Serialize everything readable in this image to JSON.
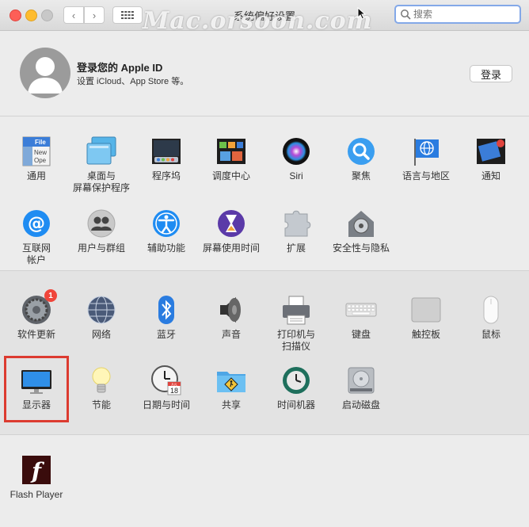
{
  "window": {
    "title": "系统偏好设置",
    "watermark": "Mac.orsoon.com"
  },
  "toolbar": {
    "back_label": "‹",
    "forward_label": "›"
  },
  "search": {
    "placeholder": "搜索"
  },
  "profile": {
    "title": "登录您的 Apple ID",
    "subtitle": "设置 iCloud、App Store 等。",
    "login_label": "登录"
  },
  "row1": [
    "通用",
    "桌面与\n屏幕保护程序",
    "程序坞",
    "调度中心",
    "Siri",
    "聚焦",
    "语言与地区",
    "通知"
  ],
  "row2": [
    "互联网\n帐户",
    "用户与群组",
    "辅助功能",
    "屏幕使用时间",
    "扩展",
    "安全性与隐私"
  ],
  "row3": [
    "软件更新",
    "网络",
    "蓝牙",
    "声音",
    "打印机与\n扫描仪",
    "键盘",
    "触控板",
    "鼠标"
  ],
  "row4": [
    "显示器",
    "节能",
    "日期与时间",
    "共享",
    "时间机器",
    "启动磁盘"
  ],
  "other": [
    "Flash Player"
  ],
  "general_icon_text": {
    "file": "File",
    "new": "New",
    "ope": "Ope"
  },
  "software_update_badge": "1",
  "calendar": {
    "month": "JUL",
    "day": "18"
  },
  "colors": {
    "highlight": "#dc3b30",
    "search_focus": "#83a8e8"
  }
}
